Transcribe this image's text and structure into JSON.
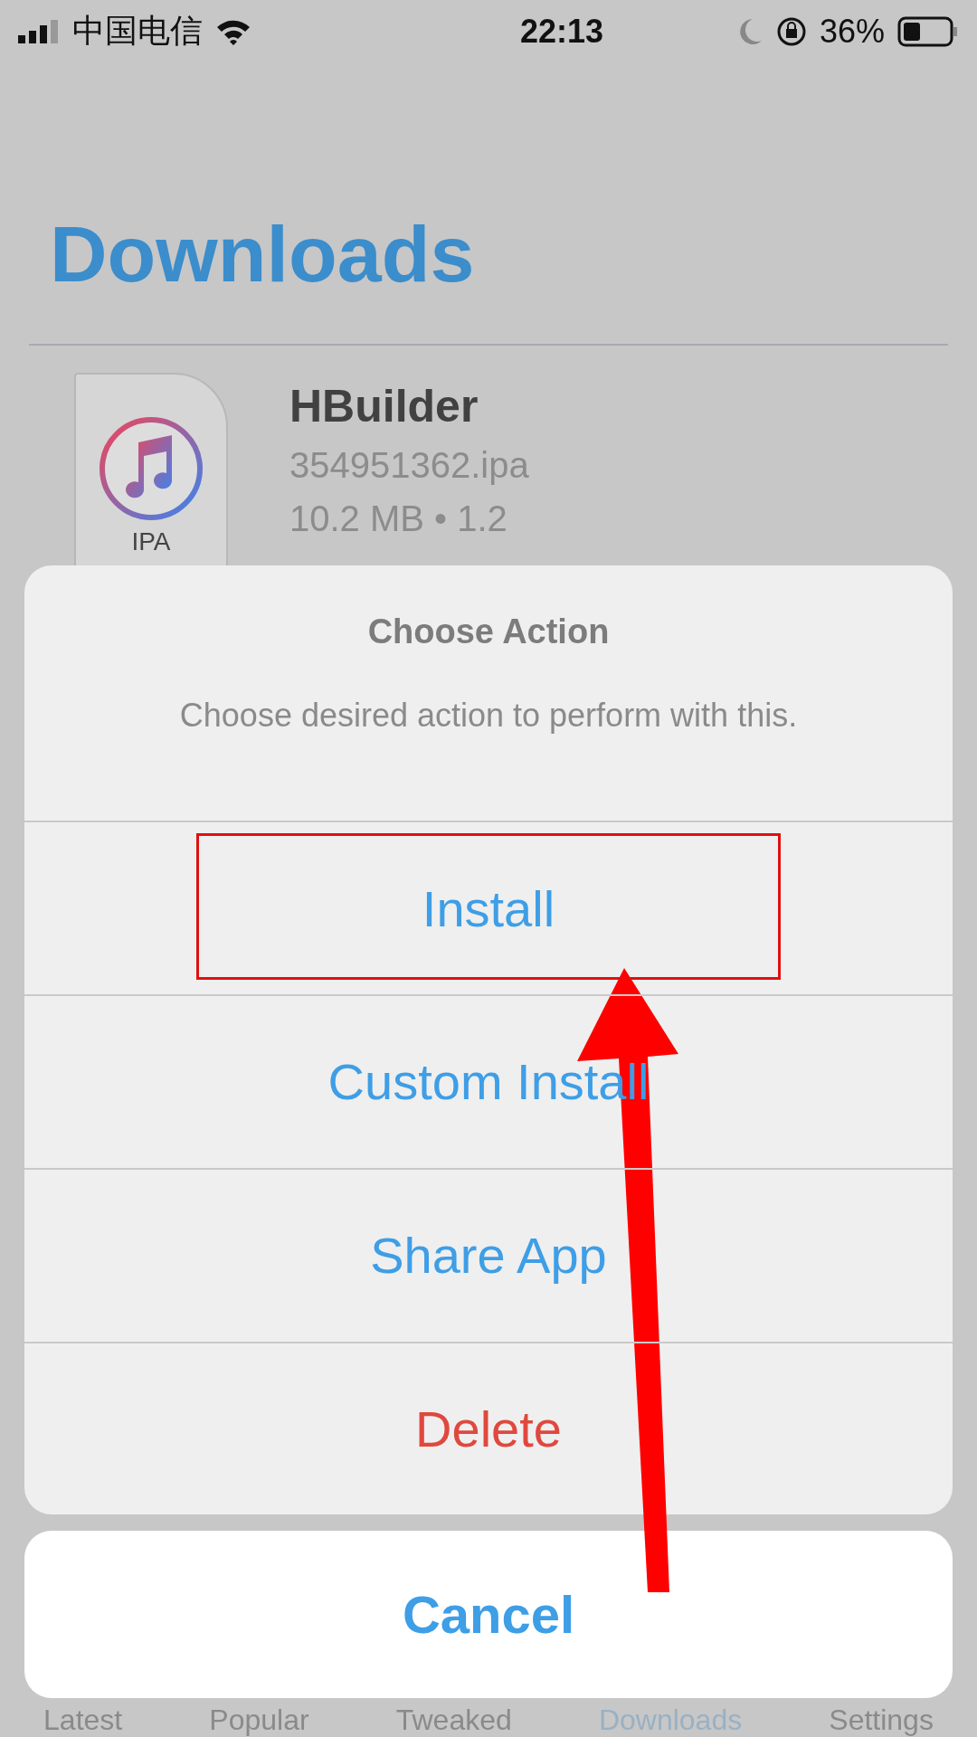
{
  "status_bar": {
    "carrier": "中国电信",
    "time": "22:13",
    "battery": "36%"
  },
  "title": "Downloads",
  "download": {
    "icon_label": "IPA",
    "name": "HBuilder",
    "file": "354951362.ipa",
    "meta": "10.2 MB • 1.2"
  },
  "action_sheet": {
    "title": "Choose Action",
    "message": "Choose desired action to perform with this.",
    "actions": [
      {
        "label": "Install",
        "kind": "default",
        "highlighted": true
      },
      {
        "label": "Custom Install",
        "kind": "default",
        "highlighted": false
      },
      {
        "label": "Share App",
        "kind": "default",
        "highlighted": false
      },
      {
        "label": "Delete",
        "kind": "destructive",
        "highlighted": false
      }
    ],
    "cancel": "Cancel"
  },
  "tab_bar": [
    {
      "label": "Latest",
      "selected": false
    },
    {
      "label": "Popular",
      "selected": false
    },
    {
      "label": "Tweaked",
      "selected": false
    },
    {
      "label": "Downloads",
      "selected": true
    },
    {
      "label": "Settings",
      "selected": false
    }
  ]
}
